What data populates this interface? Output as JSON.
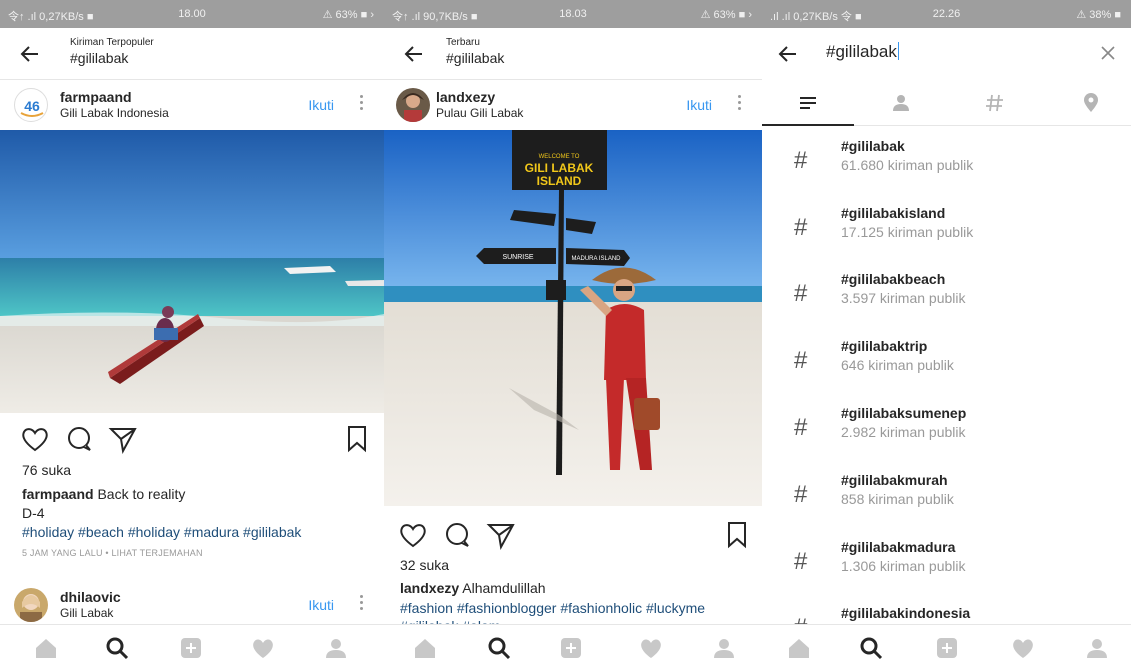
{
  "panels": [
    {
      "status": {
        "left": "令↑ .ıl 0,27KB/s ■",
        "time": "18.00",
        "right": "⚠ 63% ■ ›"
      },
      "header": {
        "subtitle": "Kiriman Terpopuler",
        "title": "#gililabak"
      },
      "post": {
        "username": "farmpaand",
        "location": "Gili Labak Indonesia",
        "follow": "Ikuti",
        "likes": "76 suka",
        "caption_user": "farmpaand",
        "caption_text": "Back to reality",
        "caption_line2": "D-4",
        "tags": "#holiday #beach #holiday #madura #gililabak",
        "meta": "5 JAM YANG LALU • LIHAT TERJEMAHAN"
      },
      "next_post": {
        "username": "dhilaovic",
        "location": "Gili Labak",
        "follow": "Ikuti"
      }
    },
    {
      "status": {
        "left": "令↑ .ıl 90,7KB/s ■",
        "time": "18.03",
        "right": "⚠ 63% ■ ›"
      },
      "header": {
        "subtitle": "Terbaru",
        "title": "#gililabak"
      },
      "post": {
        "username": "landxezy",
        "location": "Pulau Gili Labak",
        "follow": "Ikuti",
        "likes": "32 suka",
        "caption_user": "landxezy",
        "caption_text": "Alhamdulillah",
        "tags": "#fashion #fashionblogger #fashionholic #luckyme",
        "tags_line2": "#gililabak #alam",
        "sign_welcome": "WELCOME TO",
        "sign_title_1": "GILI LABAK",
        "sign_title_2": "ISLAND",
        "sign_sunrise": "SUNRISE",
        "sign_madura": "MADURA ISLAND"
      }
    },
    {
      "status": {
        "left": ".ıl .ıl 0,27KB/s 令 ■",
        "time": "22.26",
        "right": "⚠ 38% ■"
      },
      "search": {
        "query": "#gililabak"
      },
      "results": [
        {
          "name": "#gililabak",
          "count": "61.680 kiriman publik"
        },
        {
          "name": "#gililabakisland",
          "count": "17.125 kiriman publik"
        },
        {
          "name": "#gililabakbeach",
          "count": "3.597 kiriman publik"
        },
        {
          "name": "#gililabaktrip",
          "count": "646 kiriman publik"
        },
        {
          "name": "#gililabaksumenep",
          "count": "2.982 kiriman publik"
        },
        {
          "name": "#gililabakmurah",
          "count": "858 kiriman publik"
        },
        {
          "name": "#gililabakmadura",
          "count": "1.306 kiriman publik"
        },
        {
          "name": "#gililabakindonesia",
          "count": ""
        }
      ],
      "hash_symbol": "#"
    }
  ],
  "colors": {
    "accent": "#3897f0",
    "hashtag": "#1f4e79",
    "status_bar": "#9e9e9e"
  },
  "icons": [
    "back-arrow-icon",
    "more-icon",
    "heart-icon",
    "comment-icon",
    "share-icon",
    "bookmark-icon",
    "home-icon",
    "search-icon",
    "add-icon",
    "activity-heart-icon",
    "profile-icon",
    "close-icon",
    "top-tab-icon",
    "people-tab-icon",
    "tags-tab-icon",
    "places-tab-icon"
  ]
}
